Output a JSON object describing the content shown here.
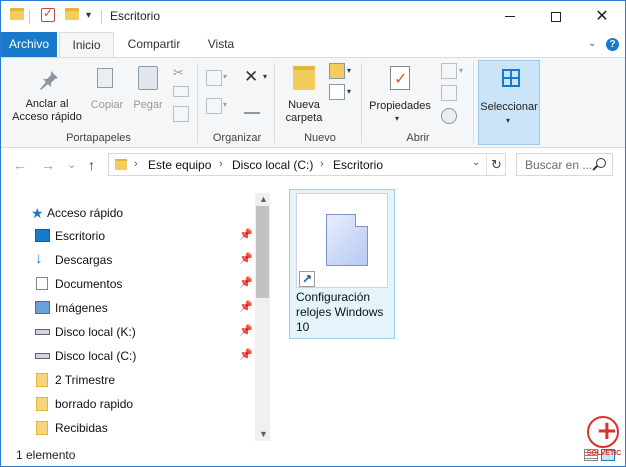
{
  "window": {
    "title": "Escritorio",
    "controls": {
      "minimize": "minimize",
      "maximize": "maximize",
      "close": "✕"
    }
  },
  "quick_access": {
    "dropdown": "▾"
  },
  "tabs": [
    {
      "label": "Archivo",
      "active": false
    },
    {
      "label": "Inicio",
      "active": true
    },
    {
      "label": "Compartir",
      "active": false
    },
    {
      "label": "Vista",
      "active": false
    }
  ],
  "ribbon_extra": {
    "expand": "⌄",
    "help": "?"
  },
  "ribbon": {
    "portapapeles": {
      "label": "Portapapeles",
      "anclar": "Anclar al\nAcceso rápido",
      "copiar": "Copiar",
      "pegar": "Pegar"
    },
    "organizar": {
      "label": "Organizar"
    },
    "nuevo": {
      "label": "Nuevo",
      "nueva_carpeta": "Nueva\ncarpeta"
    },
    "abrir": {
      "label": "Abrir",
      "propiedades": "Propiedades"
    },
    "seleccionar": {
      "label": "Seleccionar"
    }
  },
  "navigation": {
    "back": "←",
    "forward": "→",
    "recent": "⌄",
    "up": "↑",
    "breadcrumb": [
      "Este equipo",
      "Disco local (C:)",
      "Escritorio"
    ],
    "separator": "›",
    "search_placeholder": "Buscar en ..."
  },
  "nav_pane": {
    "items": [
      {
        "label": "Acceso rápido",
        "icon": "star-icon",
        "pinned": false
      },
      {
        "label": "Escritorio",
        "icon": "desktop-icon",
        "pinned": true
      },
      {
        "label": "Descargas",
        "icon": "download-icon",
        "pinned": true
      },
      {
        "label": "Documentos",
        "icon": "documents-icon",
        "pinned": true
      },
      {
        "label": "Imágenes",
        "icon": "pictures-icon",
        "pinned": true
      },
      {
        "label": "Disco local (K:)",
        "icon": "drive-icon",
        "pinned": true
      },
      {
        "label": "Disco local (C:)",
        "icon": "drive-icon",
        "pinned": true
      },
      {
        "label": "2 Trimestre",
        "icon": "folder-icon",
        "pinned": false
      },
      {
        "label": "borrado rapido",
        "icon": "folder-icon",
        "pinned": false
      },
      {
        "label": "Recibidas",
        "icon": "folder-icon",
        "pinned": false
      }
    ]
  },
  "files": [
    {
      "name": "Configuración relojes Windows 10",
      "type": "shortcut",
      "selected": true
    }
  ],
  "status": {
    "count": "1 elemento"
  },
  "logo": {
    "text": "SOLVETIC"
  }
}
